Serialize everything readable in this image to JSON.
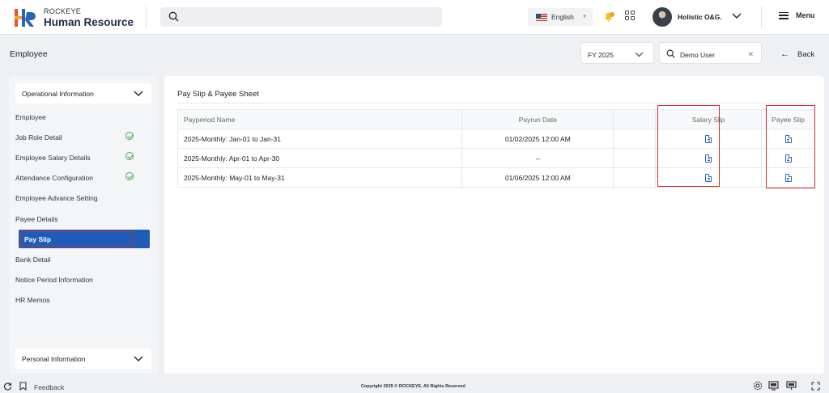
{
  "app": {
    "brand_top": "ROCKEYE",
    "brand_bottom": "Human Resource"
  },
  "header": {
    "search_placeholder": "",
    "language": "English",
    "user_name": "Holistic O&G.",
    "menu_label": "Menu"
  },
  "subheader": {
    "page_title": "Employee",
    "fiscal_year": "FY 2025",
    "selected_user": "Demo User",
    "back_label": "Back"
  },
  "sidebar": {
    "group1": "Operational Information",
    "items": [
      {
        "label": "Employee",
        "done": false
      },
      {
        "label": "Job Role Detail",
        "done": true
      },
      {
        "label": "Employee Salary Details",
        "done": true
      },
      {
        "label": "Attendance Configuration",
        "done": true
      },
      {
        "label": "Employee Advance Setting",
        "done": false
      },
      {
        "label": "Payee Details",
        "done": false
      },
      {
        "label": "Pay Slip",
        "active": true
      },
      {
        "label": "Bank Detail",
        "done": false
      },
      {
        "label": "Notice Period Information",
        "done": false
      },
      {
        "label": "HR Memos",
        "done": false
      }
    ],
    "group2": "Personal Information"
  },
  "main": {
    "section_title": "Pay Slip & Payee Sheet",
    "columns": [
      "Payperiod Name",
      "Payrun Date",
      "",
      "Salary Slip",
      "Payee Slip"
    ],
    "rows": [
      {
        "name": "2025-Monthly: Jan-01 to Jan-31",
        "date": "01/02/2025 12:00 AM"
      },
      {
        "name": "2025-Monthly: Apr-01 to Apr-30",
        "date": "--"
      },
      {
        "name": "2025-Monthly: May-01 to May-31",
        "date": "01/06/2025 12:00 AM"
      }
    ]
  },
  "footer": {
    "feedback": "Feedback",
    "copyright": "Copyright 2025 © ROCKEYE. All Rights Reserved"
  },
  "colors": {
    "primary": "#1f5bb8",
    "highlight": "#d42a2a",
    "success": "#46a75c"
  },
  "icons": [
    "search-icon",
    "bell-icon",
    "apps-grid-icon",
    "chevron-down-icon",
    "close-icon",
    "arrow-left-icon",
    "check-circle-icon",
    "download-document-icon",
    "refresh-icon",
    "bookmark-icon",
    "settings-icon",
    "monitor-icon",
    "expand-icon"
  ]
}
